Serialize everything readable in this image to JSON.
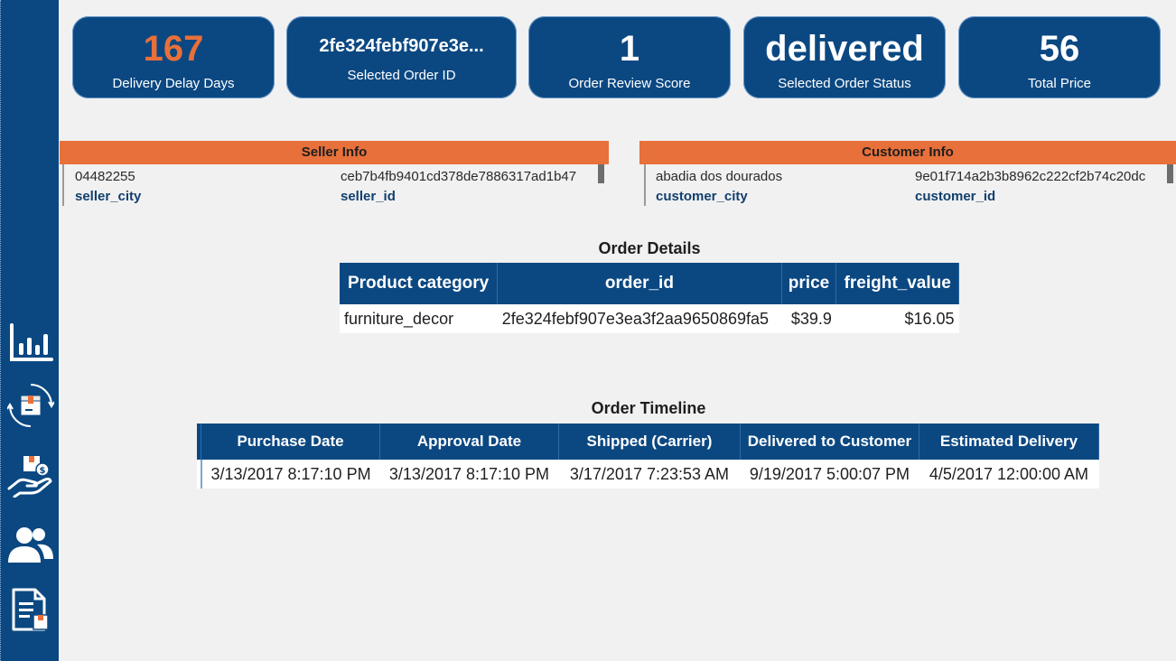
{
  "kpis": {
    "delivery_delay": {
      "value": "167",
      "label": "Delivery Delay Days"
    },
    "order_id": {
      "value": "2fe324febf907e3e...",
      "label": "Selected Order ID"
    },
    "review_score": {
      "value": "1",
      "label": "Order Review Score"
    },
    "order_status": {
      "value": "delivered",
      "label": "Selected Order Status"
    },
    "total_price": {
      "value": "56",
      "label": "Total Price"
    }
  },
  "colors": {
    "accent": "#e8703a",
    "navy": "#0b4882"
  },
  "seller": {
    "title": "Seller Info",
    "city_value": "04482255",
    "city_label": "seller_city",
    "id_value": "ceb7b4fb9401cd378de7886317ad1b47",
    "id_label": "seller_id"
  },
  "customer": {
    "title": "Customer Info",
    "city_value": "abadia dos dourados",
    "city_label": "customer_city",
    "id_value": "9e01f714a2b3b8962c222cf2b74c20dc",
    "id_label": "customer_id"
  },
  "order_details": {
    "title": "Order Details",
    "headers": [
      "Product category",
      "order_id",
      "price",
      "freight_value"
    ],
    "row": [
      "furniture_decor",
      "2fe324febf907e3ea3f2aa9650869fa5",
      "$39.9",
      "$16.05"
    ]
  },
  "timeline": {
    "title": "Order Timeline",
    "headers": [
      "Purchase Date",
      "Approval Date",
      "Shipped (Carrier)",
      "Delivered to Customer",
      "Estimated Delivery"
    ],
    "row": [
      "3/13/2017 8:17:10 PM",
      "3/13/2017 8:17:10 PM",
      "3/17/2017 7:23:53 AM",
      "9/19/2017 5:00:07 PM",
      "4/5/2017 12:00:00 AM"
    ]
  },
  "nav_icons": [
    "bar-chart-icon",
    "package-refresh-icon",
    "hand-money-icon",
    "users-icon",
    "document-icon"
  ]
}
